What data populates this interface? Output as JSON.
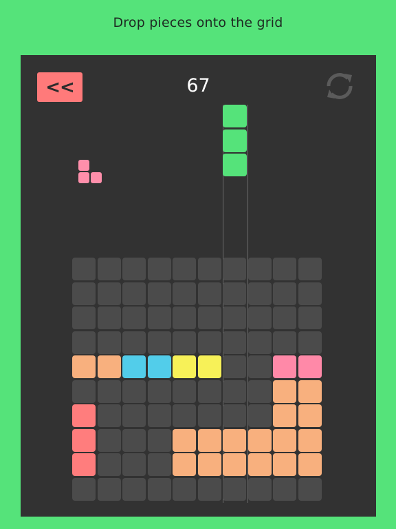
{
  "header": {
    "instruction": "Drop pieces onto the grid"
  },
  "toolbar": {
    "back_label": "<<",
    "back_color": "#ff7a7a",
    "score": "67",
    "refresh_icon": "refresh-icon"
  },
  "colors": {
    "background": "#55e37a",
    "board": "#323232",
    "empty": "#4b4b4b",
    "orange": "#f8b07e",
    "blue": "#52cdea",
    "yellow": "#f7f158",
    "pink": "#ff89a8",
    "red": "#ff7d7d",
    "green": "#55e37a",
    "preview_pink": "#ff8fab"
  },
  "next_piece": {
    "color": "preview_pink",
    "cells": [
      [
        0,
        0
      ],
      [
        1,
        0
      ],
      [
        1,
        1
      ]
    ]
  },
  "falling_piece": {
    "color": "green",
    "column": 6,
    "cells": [
      [
        0,
        0
      ],
      [
        1,
        0
      ],
      [
        2,
        0
      ]
    ]
  },
  "grid": {
    "cols": 10,
    "rows": 10,
    "cells": [
      [
        "",
        "",
        "",
        "",
        "",
        "",
        "",
        "",
        "",
        ""
      ],
      [
        "",
        "",
        "",
        "",
        "",
        "",
        "",
        "",
        "",
        ""
      ],
      [
        "",
        "",
        "",
        "",
        "",
        "",
        "",
        "",
        "",
        ""
      ],
      [
        "",
        "",
        "",
        "",
        "",
        "",
        "",
        "",
        "",
        ""
      ],
      [
        "orange",
        "orange",
        "blue",
        "blue",
        "yellow",
        "yellow",
        "",
        "",
        "pink",
        "pink"
      ],
      [
        "",
        "",
        "",
        "",
        "",
        "",
        "",
        "",
        "orange",
        "orange"
      ],
      [
        "red",
        "",
        "",
        "",
        "",
        "",
        "",
        "",
        "orange",
        "orange"
      ],
      [
        "red",
        "",
        "",
        "",
        "orange",
        "orange",
        "orange",
        "orange",
        "orange",
        "orange"
      ],
      [
        "red",
        "",
        "",
        "",
        "orange",
        "orange",
        "orange",
        "orange",
        "orange",
        "orange"
      ],
      [
        "",
        "",
        "",
        "",
        "",
        "",
        "",
        "",
        "",
        ""
      ]
    ]
  }
}
